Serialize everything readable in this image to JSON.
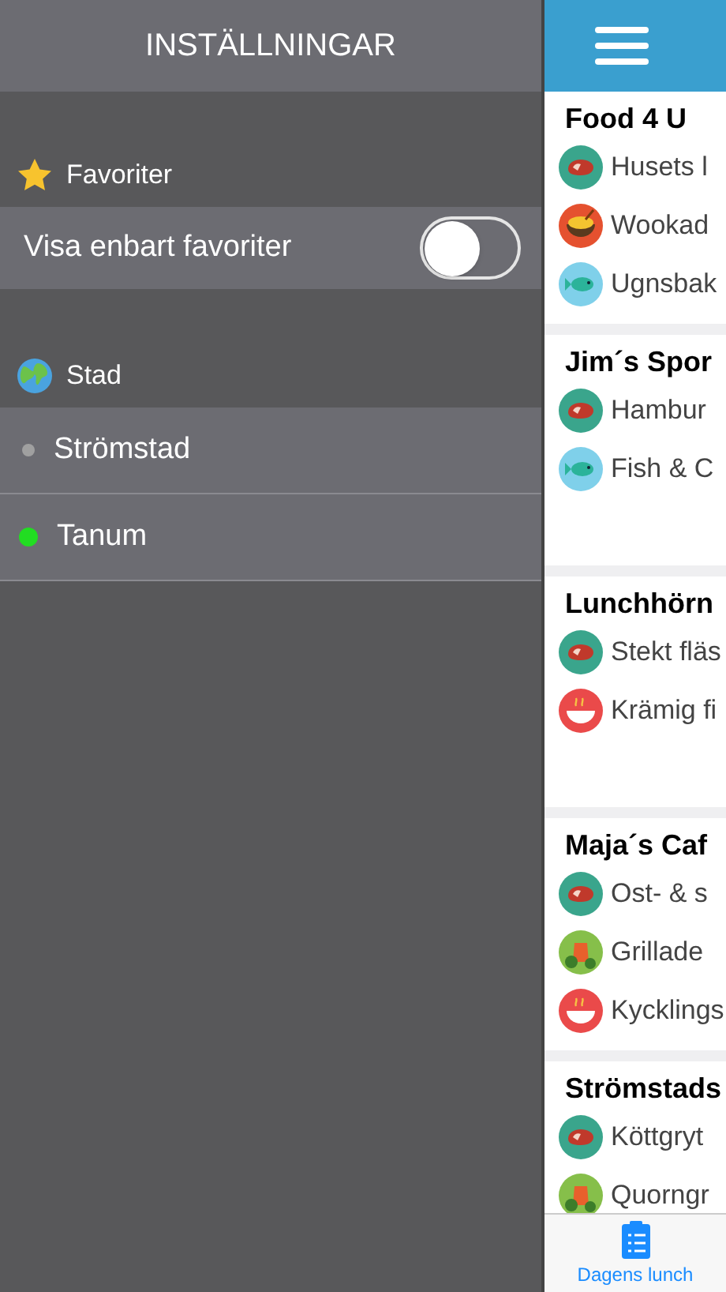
{
  "settings": {
    "title": "INSTÄLLNINGAR",
    "favorites": {
      "heading": "Favoriter",
      "toggle": {
        "label": "Visa enbart favoriter",
        "on": false
      }
    },
    "city": {
      "heading": "Stad",
      "items": [
        {
          "label": "Strömstad",
          "color": "#a0a0a0"
        },
        {
          "label": "Tanum",
          "color": "#22dd22"
        }
      ]
    }
  },
  "restaurants": [
    {
      "name": "Food 4 U",
      "dishes": [
        {
          "kind": "meat",
          "text": "Husets l"
        },
        {
          "kind": "noodles",
          "text": "Wookad"
        },
        {
          "kind": "fish",
          "text": "Ugnsbak"
        }
      ]
    },
    {
      "name": "Jim´s Spor",
      "dishes": [
        {
          "kind": "meat",
          "text": "Hambur"
        },
        {
          "kind": "fish",
          "text": "Fish & C"
        }
      ]
    },
    {
      "name": "Lunchhörn",
      "dishes": [
        {
          "kind": "meat",
          "text": "Stekt fläs"
        },
        {
          "kind": "soup",
          "text": "Krämig fi"
        }
      ]
    },
    {
      "name": "Maja´s Caf",
      "dishes": [
        {
          "kind": "meat",
          "text": "Ost- & s"
        },
        {
          "kind": "veg",
          "text": "Grillade"
        },
        {
          "kind": "soup",
          "text": "Kycklings"
        }
      ]
    },
    {
      "name": "Strömstads",
      "dishes": [
        {
          "kind": "meat",
          "text": "Köttgryt"
        },
        {
          "kind": "veg",
          "text": "Quorngr"
        }
      ]
    }
  ],
  "tab_bar": {
    "tabs": [
      {
        "label": "Dagens lunch",
        "selected": true
      }
    ]
  }
}
